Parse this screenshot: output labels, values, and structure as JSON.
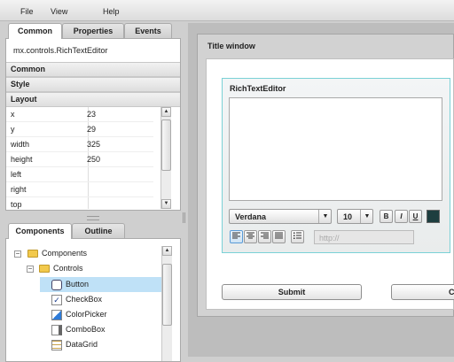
{
  "menu": {
    "file": "File",
    "view": "View",
    "help": "Help"
  },
  "properties_panel": {
    "tabs": {
      "common": "Common",
      "properties": "Properties",
      "events": "Events"
    },
    "component_path": "mx.controls.RichTextEditor",
    "sections": {
      "common": "Common",
      "style": "Style",
      "layout": "Layout"
    },
    "rows": [
      {
        "key": "x",
        "value": "23"
      },
      {
        "key": "y",
        "value": "29"
      },
      {
        "key": "width",
        "value": "325"
      },
      {
        "key": "height",
        "value": "250"
      },
      {
        "key": "left",
        "value": ""
      },
      {
        "key": "right",
        "value": ""
      },
      {
        "key": "top",
        "value": ""
      }
    ]
  },
  "components_panel": {
    "tabs": {
      "components": "Components",
      "outline": "Outline"
    },
    "tree": {
      "root": "Components",
      "controls": "Controls",
      "items": [
        "Button",
        "CheckBox",
        "ColorPicker",
        "ComboBox",
        "DataGrid"
      ],
      "selected": "Button"
    }
  },
  "stage": {
    "window_title": "Title window",
    "rte": {
      "title": "RichTextEditor",
      "font": "Verdana",
      "size": "10",
      "bold": "B",
      "italic": "I",
      "underline": "U",
      "link_placeholder": "http://",
      "color_swatch": "#1e3e3f"
    },
    "submit_label": "Submit",
    "cancel_label_partial": "C"
  },
  "colors": {
    "selection": "#bfe1f7",
    "rte_border": "#7ad1d6"
  }
}
